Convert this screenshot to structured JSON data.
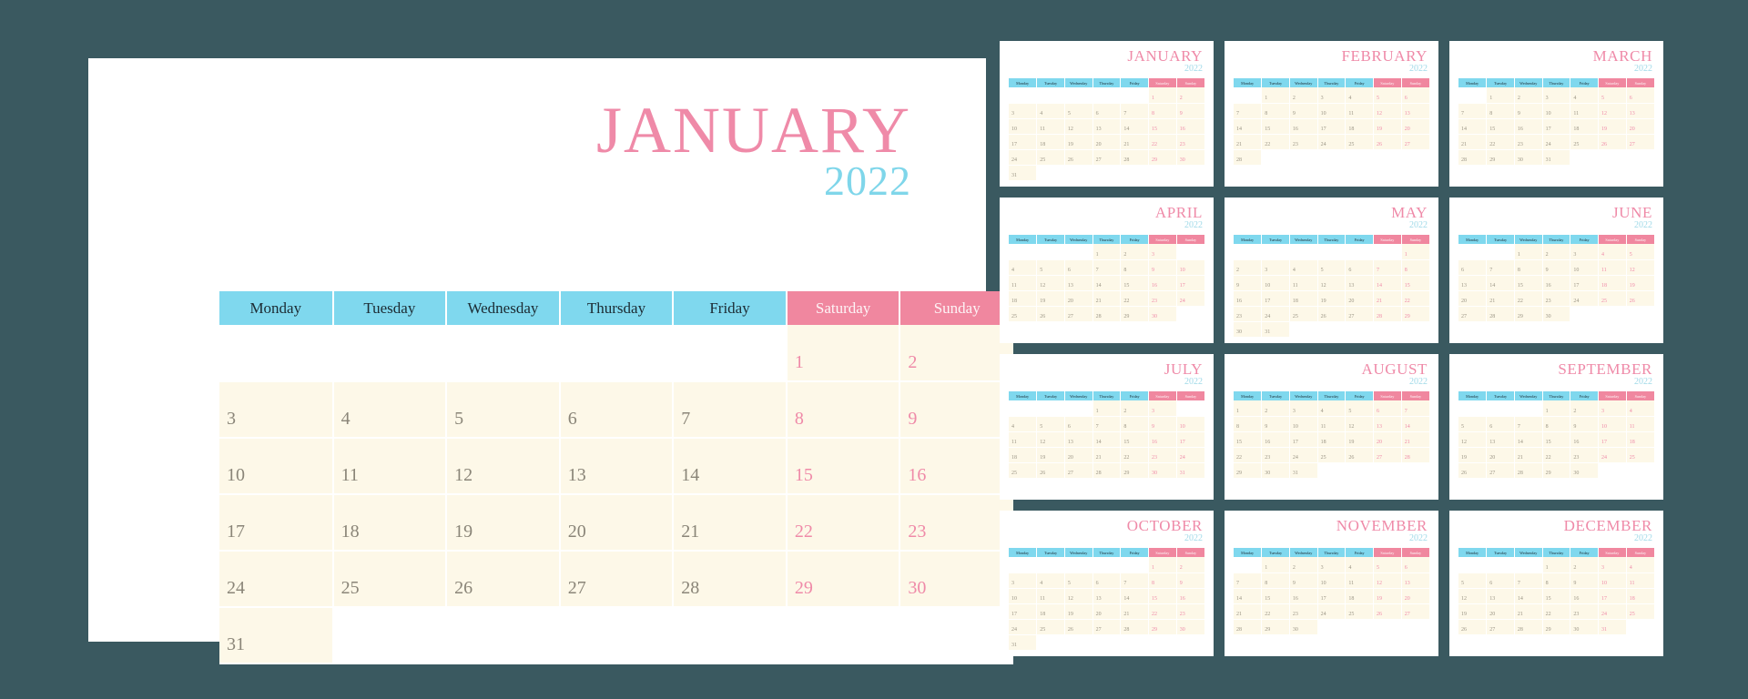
{
  "theme": {
    "background": "#3a5960",
    "card": "#ffffff",
    "month_pink": "#ef8aa8",
    "year_blue": "#7fd6ea",
    "weekday_header": "#7fd8ee",
    "weekend_header": "#f0879f",
    "cell_cream": "#fdf8e8",
    "weekday_text": "#8a8578"
  },
  "weekdays": [
    "Monday",
    "Tuesday",
    "Wednesday",
    "Thursday",
    "Friday",
    "Saturday",
    "Sunday"
  ],
  "main": {
    "month": "JANUARY",
    "year": "2022",
    "weeks": [
      [
        "",
        "",
        "",
        "",
        "",
        "1",
        "2"
      ],
      [
        "3",
        "4",
        "5",
        "6",
        "7",
        "8",
        "9"
      ],
      [
        "10",
        "11",
        "12",
        "13",
        "14",
        "15",
        "16"
      ],
      [
        "17",
        "18",
        "19",
        "20",
        "21",
        "22",
        "23"
      ],
      [
        "24",
        "25",
        "26",
        "27",
        "28",
        "29",
        "30"
      ],
      [
        "31",
        "",
        "",
        "",
        "",
        "",
        ""
      ]
    ]
  },
  "minis": [
    {
      "month": "JANUARY",
      "year": "2022",
      "weeks": [
        [
          "",
          "",
          "",
          "",
          "",
          "1",
          "2"
        ],
        [
          "3",
          "4",
          "5",
          "6",
          "7",
          "8",
          "9"
        ],
        [
          "10",
          "11",
          "12",
          "13",
          "14",
          "15",
          "16"
        ],
        [
          "17",
          "18",
          "19",
          "20",
          "21",
          "22",
          "23"
        ],
        [
          "24",
          "25",
          "26",
          "27",
          "28",
          "29",
          "30"
        ],
        [
          "31",
          "",
          "",
          "",
          "",
          "",
          ""
        ]
      ]
    },
    {
      "month": "FEBRUARY",
      "year": "2022",
      "weeks": [
        [
          "",
          "1",
          "2",
          "3",
          "4",
          "5",
          "6"
        ],
        [
          "7",
          "8",
          "9",
          "10",
          "11",
          "12",
          "13"
        ],
        [
          "14",
          "15",
          "16",
          "17",
          "18",
          "19",
          "20"
        ],
        [
          "21",
          "22",
          "23",
          "24",
          "25",
          "26",
          "27"
        ],
        [
          "28",
          "",
          "",
          "",
          "",
          "",
          ""
        ]
      ]
    },
    {
      "month": "MARCH",
      "year": "2022",
      "weeks": [
        [
          "",
          "1",
          "2",
          "3",
          "4",
          "5",
          "6"
        ],
        [
          "7",
          "8",
          "9",
          "10",
          "11",
          "12",
          "13"
        ],
        [
          "14",
          "15",
          "16",
          "17",
          "18",
          "19",
          "20"
        ],
        [
          "21",
          "22",
          "23",
          "24",
          "25",
          "26",
          "27"
        ],
        [
          "28",
          "29",
          "30",
          "31",
          "",
          "",
          ""
        ]
      ]
    },
    {
      "month": "APRIL",
      "year": "2022",
      "weeks": [
        [
          "",
          "",
          "",
          "1",
          "2",
          "3",
          ""
        ],
        [
          "4",
          "5",
          "6",
          "7",
          "8",
          "9",
          "10"
        ],
        [
          "11",
          "12",
          "13",
          "14",
          "15",
          "16",
          "17"
        ],
        [
          "18",
          "19",
          "20",
          "21",
          "22",
          "23",
          "24"
        ],
        [
          "25",
          "26",
          "27",
          "28",
          "29",
          "30",
          ""
        ]
      ]
    },
    {
      "month": "MAY",
      "year": "2022",
      "weeks": [
        [
          "",
          "",
          "",
          "",
          "",
          "",
          "1"
        ],
        [
          "2",
          "3",
          "4",
          "5",
          "6",
          "7",
          "8"
        ],
        [
          "9",
          "10",
          "11",
          "12",
          "13",
          "14",
          "15"
        ],
        [
          "16",
          "17",
          "18",
          "19",
          "20",
          "21",
          "22"
        ],
        [
          "23",
          "24",
          "25",
          "26",
          "27",
          "28",
          "29"
        ],
        [
          "30",
          "31",
          "",
          "",
          "",
          "",
          ""
        ]
      ]
    },
    {
      "month": "JUNE",
      "year": "2022",
      "weeks": [
        [
          "",
          "",
          "1",
          "2",
          "3",
          "4",
          "5"
        ],
        [
          "6",
          "7",
          "8",
          "9",
          "10",
          "11",
          "12"
        ],
        [
          "13",
          "14",
          "15",
          "16",
          "17",
          "18",
          "19"
        ],
        [
          "20",
          "21",
          "22",
          "23",
          "24",
          "25",
          "26"
        ],
        [
          "27",
          "28",
          "29",
          "30",
          "",
          "",
          ""
        ]
      ]
    },
    {
      "month": "JULY",
      "year": "2022",
      "weeks": [
        [
          "",
          "",
          "",
          "1",
          "2",
          "3",
          ""
        ],
        [
          "4",
          "5",
          "6",
          "7",
          "8",
          "9",
          "10"
        ],
        [
          "11",
          "12",
          "13",
          "14",
          "15",
          "16",
          "17"
        ],
        [
          "18",
          "19",
          "20",
          "21",
          "22",
          "23",
          "24"
        ],
        [
          "25",
          "26",
          "27",
          "28",
          "29",
          "30",
          "31"
        ]
      ]
    },
    {
      "month": "AUGUST",
      "year": "2022",
      "weeks": [
        [
          "1",
          "2",
          "3",
          "4",
          "5",
          "6",
          "7"
        ],
        [
          "8",
          "9",
          "10",
          "11",
          "12",
          "13",
          "14"
        ],
        [
          "15",
          "16",
          "17",
          "18",
          "19",
          "20",
          "21"
        ],
        [
          "22",
          "23",
          "24",
          "25",
          "26",
          "27",
          "28"
        ],
        [
          "29",
          "30",
          "31",
          "",
          "",
          "",
          ""
        ]
      ]
    },
    {
      "month": "SEPTEMBER",
      "year": "2022",
      "weeks": [
        [
          "",
          "",
          "",
          "1",
          "2",
          "3",
          "4"
        ],
        [
          "5",
          "6",
          "7",
          "8",
          "9",
          "10",
          "11"
        ],
        [
          "12",
          "13",
          "14",
          "15",
          "16",
          "17",
          "18"
        ],
        [
          "19",
          "20",
          "21",
          "22",
          "23",
          "24",
          "25"
        ],
        [
          "26",
          "27",
          "28",
          "29",
          "30",
          "",
          ""
        ]
      ]
    },
    {
      "month": "OCTOBER",
      "year": "2022",
      "weeks": [
        [
          "",
          "",
          "",
          "",
          "",
          "1",
          "2"
        ],
        [
          "3",
          "4",
          "5",
          "6",
          "7",
          "8",
          "9"
        ],
        [
          "10",
          "11",
          "12",
          "13",
          "14",
          "15",
          "16"
        ],
        [
          "17",
          "18",
          "19",
          "20",
          "21",
          "22",
          "23"
        ],
        [
          "24",
          "25",
          "26",
          "27",
          "28",
          "29",
          "30"
        ],
        [
          "31",
          "",
          "",
          "",
          "",
          "",
          ""
        ]
      ]
    },
    {
      "month": "NOVEMBER",
      "year": "2022",
      "weeks": [
        [
          "",
          "1",
          "2",
          "3",
          "4",
          "5",
          "6"
        ],
        [
          "7",
          "8",
          "9",
          "10",
          "11",
          "12",
          "13"
        ],
        [
          "14",
          "15",
          "16",
          "17",
          "18",
          "19",
          "20"
        ],
        [
          "21",
          "22",
          "23",
          "24",
          "25",
          "26",
          "27"
        ],
        [
          "28",
          "29",
          "30",
          "",
          "",
          "",
          ""
        ]
      ]
    },
    {
      "month": "DECEMBER",
      "year": "2022",
      "weeks": [
        [
          "",
          "",
          "",
          "1",
          "2",
          "3",
          "4"
        ],
        [
          "5",
          "6",
          "7",
          "8",
          "9",
          "10",
          "11"
        ],
        [
          "12",
          "13",
          "14",
          "15",
          "16",
          "17",
          "18"
        ],
        [
          "19",
          "20",
          "21",
          "22",
          "23",
          "24",
          "25"
        ],
        [
          "26",
          "27",
          "28",
          "29",
          "30",
          "31",
          ""
        ]
      ]
    }
  ]
}
